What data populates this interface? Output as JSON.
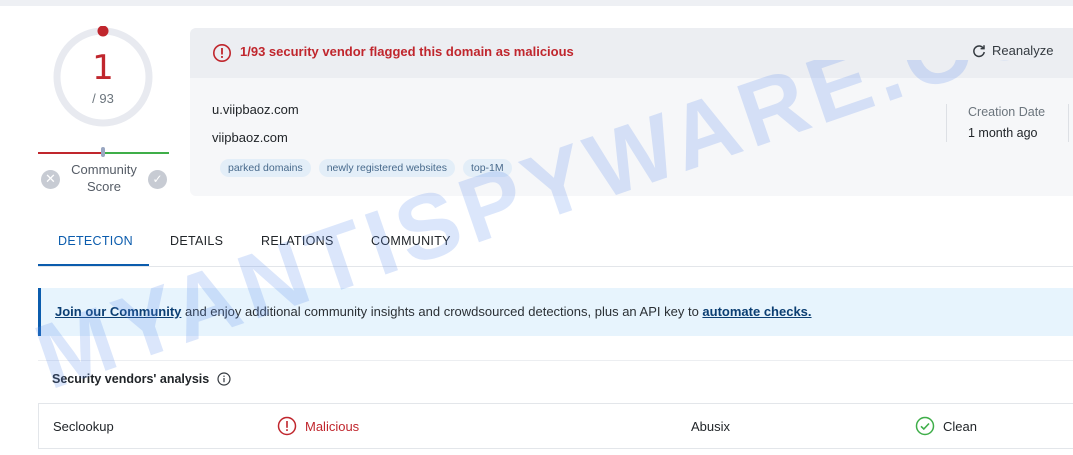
{
  "score": {
    "positives": "1",
    "total": "/ 93",
    "community_label_1": "Community",
    "community_label_2": "Score"
  },
  "header": {
    "alert_text": "1/93 security vendor flagged this domain as malicious",
    "reanalyze_label": "Reanalyze",
    "domain_primary": "u.viipbaoz.com",
    "domain_secondary": "viipbaoz.com",
    "tags": [
      "parked domains",
      "newly registered websites",
      "top-1M"
    ],
    "creation_date_label": "Creation Date",
    "creation_date_value": "1 month ago"
  },
  "tabs": [
    "DETECTION",
    "DETAILS",
    "RELATIONS",
    "COMMUNITY"
  ],
  "banner": {
    "link1": "Join our Community",
    "middle": " and enjoy additional community insights and crowdsourced detections, plus an API key to ",
    "link2": "automate checks."
  },
  "vendors": {
    "title": "Security vendors' analysis",
    "rows": [
      {
        "vendor_a": "Seclookup",
        "result_a": "Malicious",
        "vendor_b": "Abusix",
        "result_b": "Clean"
      }
    ]
  },
  "watermark": "MYANTISPYWARE.COM",
  "colors": {
    "malicious": "#c0262d",
    "clean": "#3fae49",
    "accent": "#0b5cad",
    "watermark": "#5b8def"
  }
}
